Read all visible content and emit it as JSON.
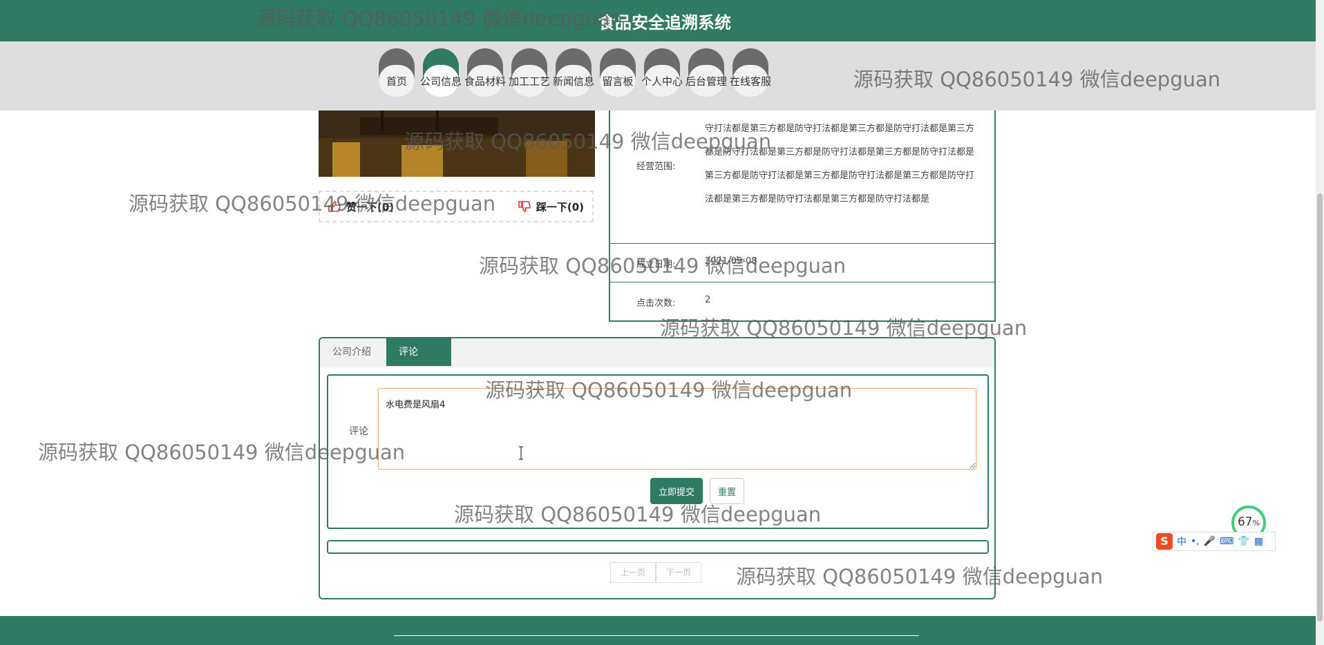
{
  "header": {
    "title": "食品安全追溯系统"
  },
  "nav": {
    "items": [
      {
        "label": "首页",
        "active": false
      },
      {
        "label": "公司信息",
        "active": true
      },
      {
        "label": "食品材料",
        "active": false
      },
      {
        "label": "加工工艺",
        "active": false
      },
      {
        "label": "新闻信息",
        "active": false
      },
      {
        "label": "留言板",
        "active": false
      },
      {
        "label": "个人中心",
        "active": false
      },
      {
        "label": "后台管理",
        "active": false
      },
      {
        "label": "在线客服",
        "active": false
      }
    ]
  },
  "votes": {
    "like_label": "赞一下(0)",
    "dislike_label": "踩一下(0)"
  },
  "info": {
    "scope_label": "经营范围:",
    "scope_value": "守打法都是第三方都是防守打法都是第三方都是防守打法都是第三方都是防守打法都是第三方都是防守打法都是第三方都是防守打法都是第三方都是防守打法都是第三方都是防守打法都是第三方都是防守打法都是第三方都是防守打法都是第三方都是防守打法都是",
    "date_label": "成立日期:",
    "date_value": "2021-09-08",
    "clicks_label": "点击次数:",
    "clicks_value": "2"
  },
  "tabs": [
    {
      "label": "公司介绍",
      "active": false
    },
    {
      "label": "评论",
      "active": true
    }
  ],
  "comment_form": {
    "label": "评论",
    "value": "水电费是风扇4",
    "submit_label": "立即提交",
    "reset_label": "重置"
  },
  "pager": {
    "prev_label": "上一页",
    "next_label": "下一页"
  },
  "widget": {
    "value": "67",
    "unit": "%"
  },
  "ime": {
    "items": [
      "中",
      "•,",
      "🎤",
      "⌨",
      "👕",
      "▦"
    ]
  },
  "watermark": {
    "text": "源码获取 QQ86050149 微信deepguan"
  },
  "colors": {
    "primary": "#2f7a62",
    "nav_band": "#dedede",
    "footer": "#2f7a62"
  }
}
